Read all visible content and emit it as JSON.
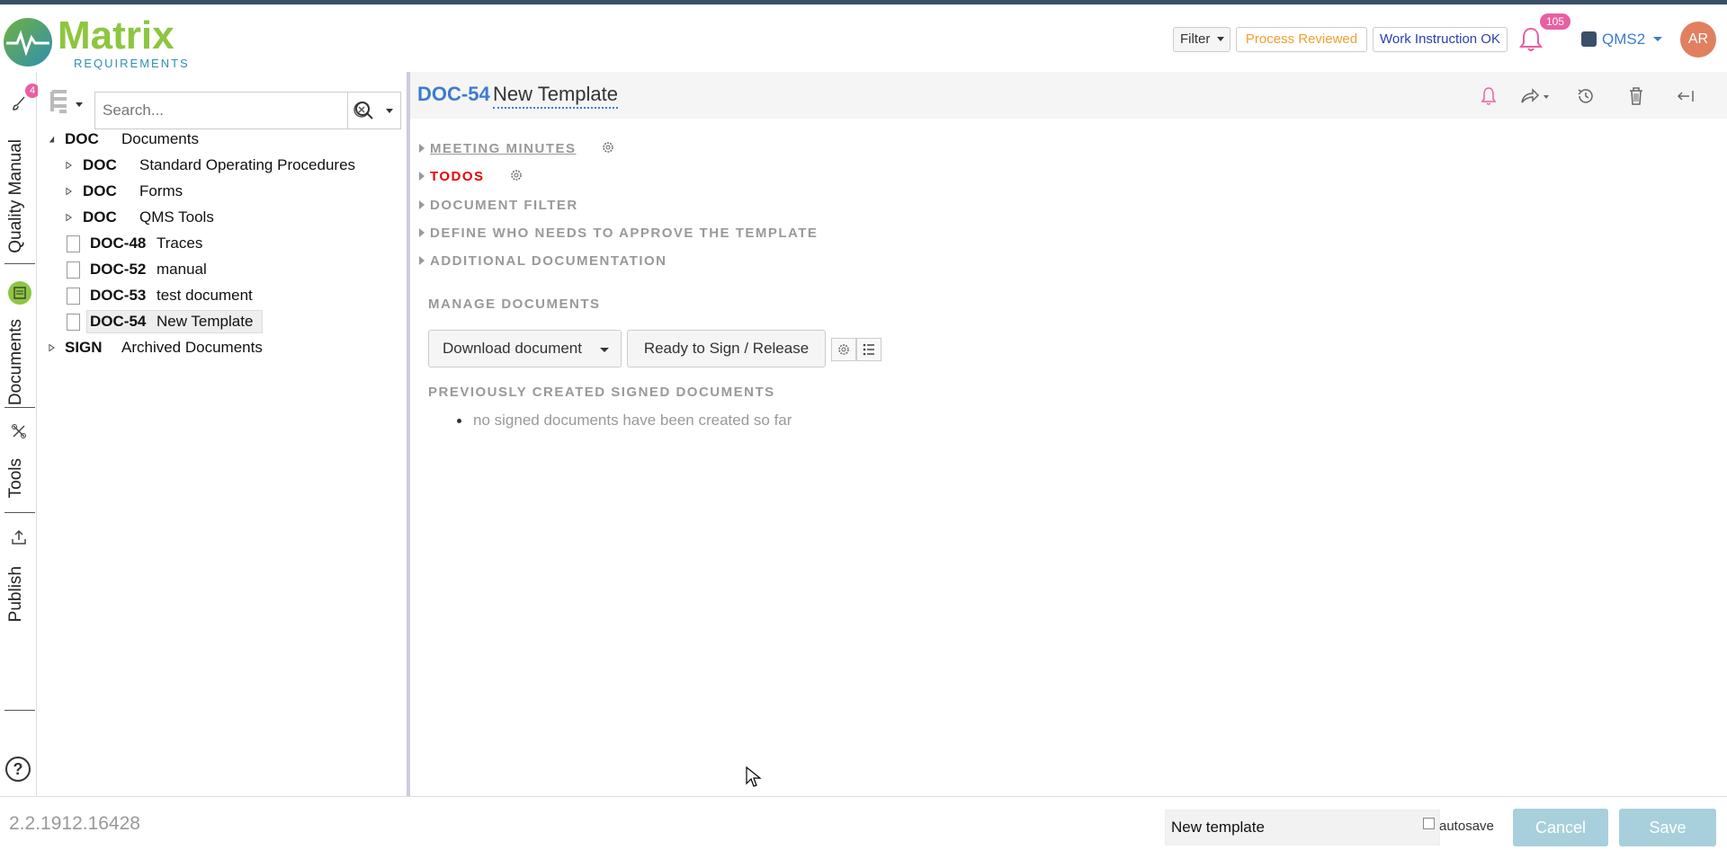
{
  "header": {
    "logo_text": "Matrix",
    "logo_sub": "REQUIREMENTS",
    "filter_label": "Filter",
    "process_reviewed": "Process Reviewed",
    "work_instruction_ok": "Work Instruction OK",
    "notification_count": "105",
    "project": "QMS2",
    "avatar_initials": "AR"
  },
  "sidebar": {
    "quality_manual_badge": "4",
    "tabs": [
      {
        "label": "Quality Manual"
      },
      {
        "label": "Documents"
      },
      {
        "label": "Tools"
      },
      {
        "label": "Publish"
      }
    ],
    "help": "?"
  },
  "tree": {
    "search_placeholder": "Search...",
    "items": [
      {
        "code": "DOC",
        "name": "Documents"
      },
      {
        "code": "DOC",
        "name": "Standard Operating Procedures"
      },
      {
        "code": "DOC",
        "name": "Forms"
      },
      {
        "code": "DOC",
        "name": "QMS Tools"
      },
      {
        "code": "DOC-48",
        "name": "Traces"
      },
      {
        "code": "DOC-52",
        "name": "manual"
      },
      {
        "code": "DOC-53",
        "name": "test document"
      },
      {
        "code": "DOC-54",
        "name": "New Template"
      },
      {
        "code": "SIGN",
        "name": "Archived Documents"
      }
    ]
  },
  "main": {
    "doc_id": "DOC-54",
    "doc_title": "New Template",
    "sections": [
      {
        "label": "MEETING MINUTES"
      },
      {
        "label": "TODOS"
      },
      {
        "label": "DOCUMENT FILTER"
      },
      {
        "label": "DEFINE WHO NEEDS TO APPROVE THE TEMPLATE"
      },
      {
        "label": "ADDITIONAL DOCUMENTATION"
      }
    ],
    "manage_title": "MANAGE DOCUMENTS",
    "download_label": "Download document",
    "sign_label": "Ready to Sign / Release",
    "previous_title": "PREVIOUSLY CREATED SIGNED DOCUMENTS",
    "previous_empty": "no signed documents have been created so far"
  },
  "footer": {
    "version": "2.2.1912.16428",
    "comment_value": "New template",
    "autosave_label": "autosave",
    "cancel_label": "Cancel",
    "save_label": "Save"
  },
  "colors": {
    "accent_blue": "#3c7bd0",
    "badge_pink": "#e85fa2",
    "todos_red": "#e00000",
    "disabled_button": "#a8d0dc",
    "brand_green": "#8dc63f"
  }
}
